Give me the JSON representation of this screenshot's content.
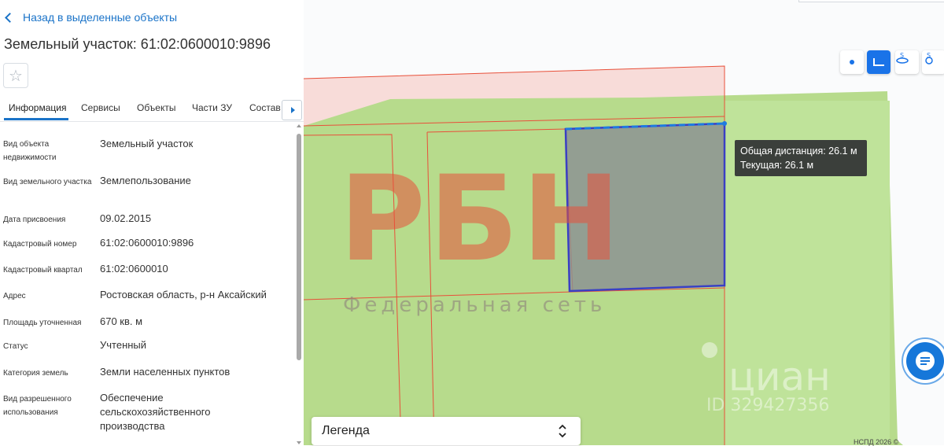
{
  "panel": {
    "back_label": "Назад в выделенные объекты",
    "title": "Земельный участок: 61:02:0600010:9896",
    "favorite_icon": "star-outline",
    "tabs": [
      "Информация",
      "Сервисы",
      "Объекты",
      "Части ЗУ",
      "Состав"
    ],
    "active_tab": "Информация",
    "info_rows": [
      {
        "label": "Вид объекта недвижимости",
        "value": "Земельный участок"
      },
      {
        "label": "Вид земельного участка",
        "value": "Землепользование"
      },
      {
        "label": "Дата присвоения",
        "value": "09.02.2015"
      },
      {
        "label": "Кадастровый номер",
        "value": "61:02:0600010:9896"
      },
      {
        "label": "Кадастровый квартал",
        "value": "61:02:0600010"
      },
      {
        "label": "Адрес",
        "value": "Ростовская область, р-н Аксайский"
      },
      {
        "label": "Площадь уточненная",
        "value": "670 кв. м"
      },
      {
        "label": "Статус",
        "value": "Учтенный"
      },
      {
        "label": "Категория земель",
        "value": "Земли населенных пунктов"
      },
      {
        "label": "Вид разрешенного использования",
        "value": "Обеспечение сельскохозяйственного производства"
      }
    ]
  },
  "map": {
    "tooltip": {
      "total": "Общая дистанция: 26.1 м",
      "current": "Текущая: 26.1 м"
    },
    "tools": [
      "point-measure-icon",
      "distance-measure-icon",
      "area-measure-icon",
      "radius-measure-icon"
    ],
    "legend_label": "Легенда",
    "copyright": "НСПД 2026 ©",
    "watermark_rbn": "РБН",
    "watermark_rbn_sub": "Федеральная сеть",
    "watermark_cian": "циан",
    "watermark_cian_id": "ID 329427356",
    "colors": {
      "parcel_fill": "#b7db8c",
      "boundary": "#e8503a",
      "selection": "#3a3fc4",
      "measure_line": "#1e7be0",
      "accent": "#1a73c8"
    }
  }
}
